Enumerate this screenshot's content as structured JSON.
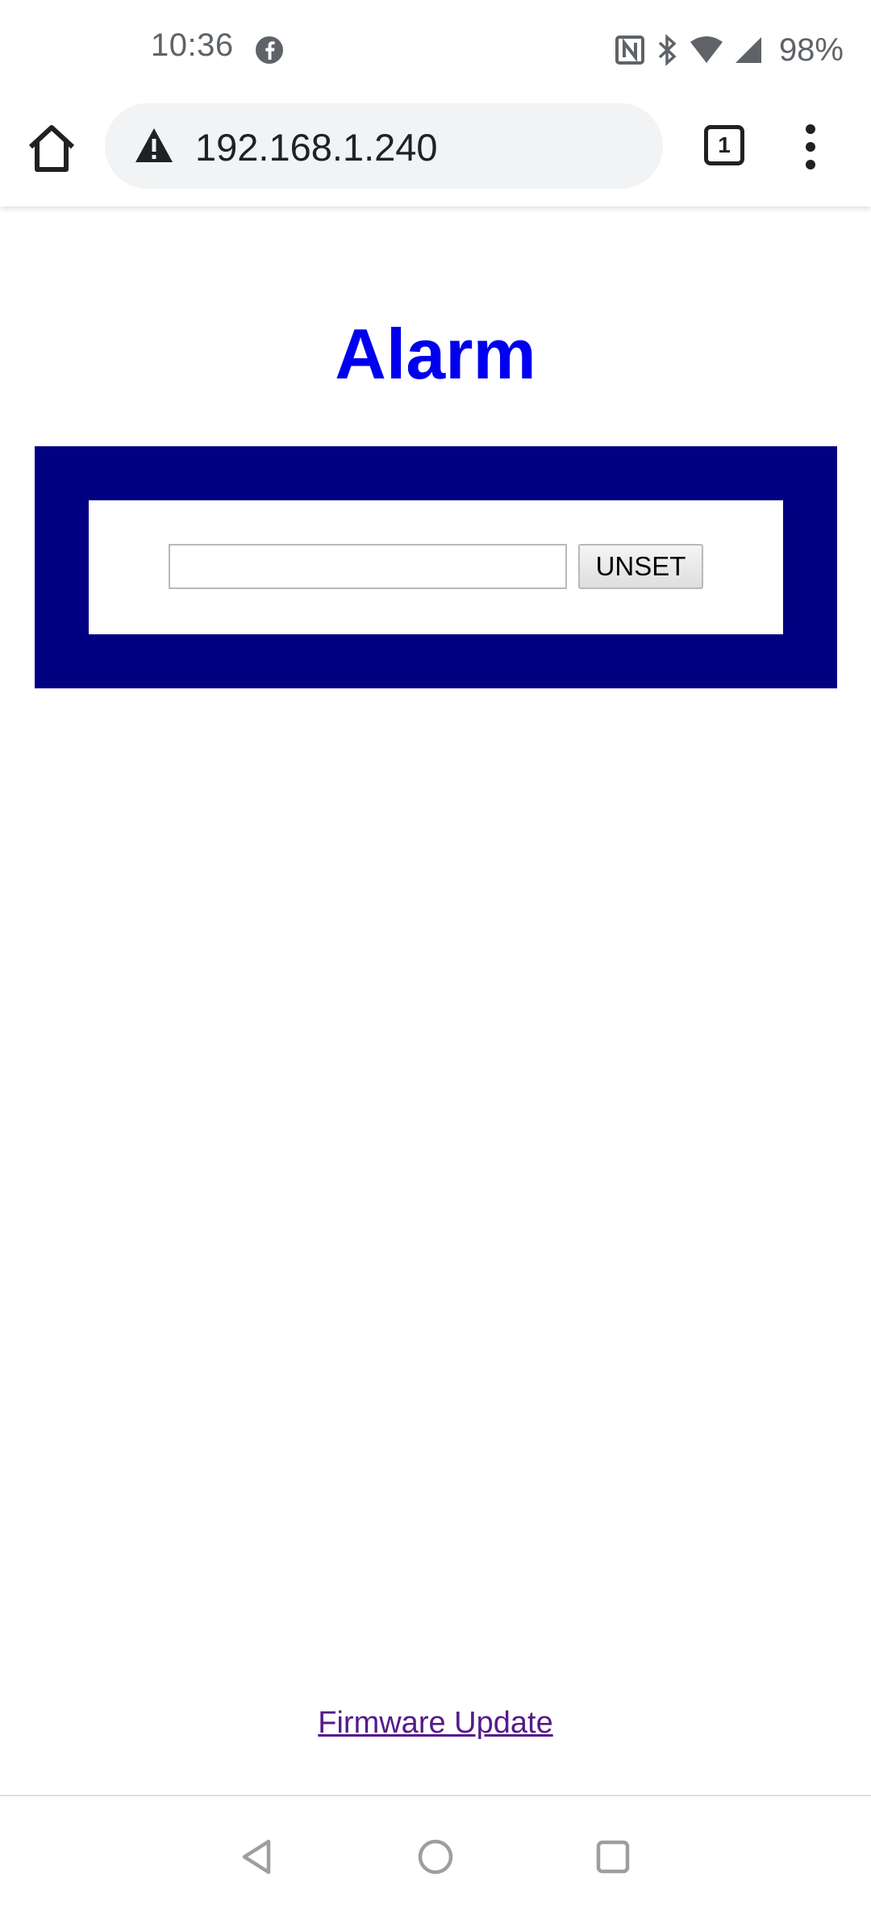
{
  "status_bar": {
    "time": "10:36",
    "battery": "98%",
    "icons": [
      "facebook-icon",
      "nfc-icon",
      "bluetooth-icon",
      "wifi-icon",
      "signal-icon"
    ]
  },
  "browser": {
    "url": "192.168.1.240",
    "tab_count": "1",
    "security_icon": "warning-triangle-icon"
  },
  "page": {
    "title": "Alarm",
    "code_input": {
      "value": "",
      "placeholder": ""
    },
    "unset_button_label": "UNSET",
    "firmware_link_label": "Firmware Update"
  },
  "colors": {
    "title": "#0000ee",
    "panel": "#000080",
    "link_visited": "#551a8b"
  },
  "nav_bar": {
    "buttons": [
      "back-icon",
      "home-icon",
      "recents-icon"
    ]
  }
}
